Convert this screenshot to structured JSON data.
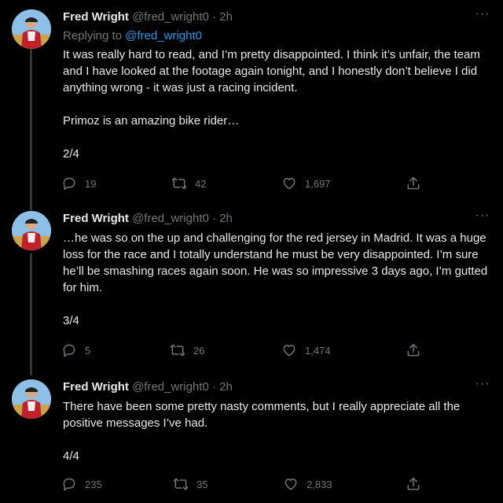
{
  "tweets": [
    {
      "name": "Fred Wright",
      "handle": "@fred_wright0",
      "time": "· 2h",
      "replying_label": "Replying to",
      "replying_to": "@fred_wright0",
      "text": "It was really hard to read, and I’m pretty disappointed. I think it’s unfair, the team and I have looked at the footage again tonight, and I honestly don’t believe I did anything wrong - it was just a racing incident.\n\nPrimoz is an amazing bike rider…\n\n2/4",
      "replies": "19",
      "retweets": "42",
      "likes": "1,697"
    },
    {
      "name": "Fred Wright",
      "handle": "@fred_wright0",
      "time": "· 2h",
      "text": "…he was so on the up and challenging for the red jersey in Madrid. It was a huge loss for the race and I totally understand he must be very disappointed. I’m sure he’ll be smashing races again soon. He was so impressive 3 days ago, I’m gutted for him.\n\n3/4",
      "replies": "5",
      "retweets": "26",
      "likes": "1,474"
    },
    {
      "name": "Fred Wright",
      "handle": "@fred_wright0",
      "time": "· 2h",
      "text": "There have been some pretty nasty comments, but I really appreciate all the positive messages I’ve had.\n\n4/4",
      "replies": "235",
      "retweets": "35",
      "likes": "2,833"
    }
  ],
  "more_glyph": "···",
  "colors": {
    "background": "#000000",
    "text": "#e7e9ea",
    "muted": "#71767b",
    "link": "#1d9bf0",
    "thread_line": "#333639"
  },
  "icons": [
    "reply-icon",
    "retweet-icon",
    "like-icon",
    "share-icon",
    "more-icon"
  ]
}
